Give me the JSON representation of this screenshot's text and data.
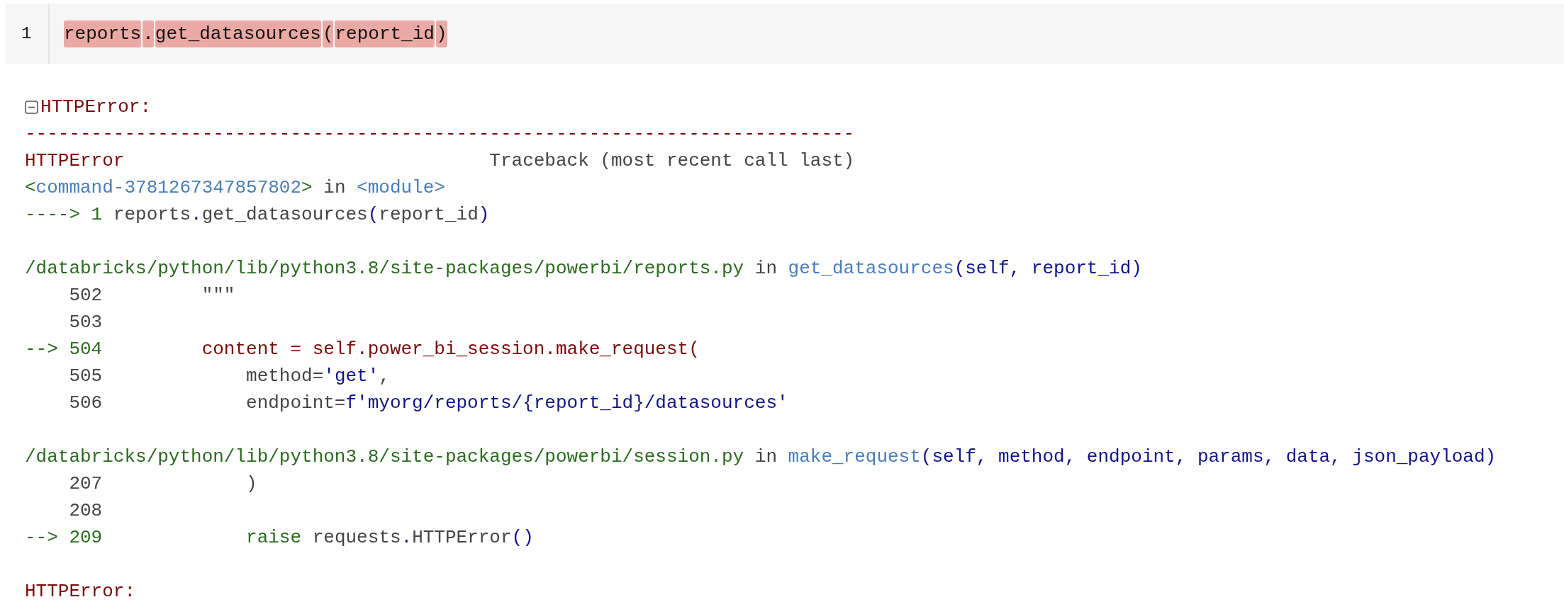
{
  "cell": {
    "line_number": "1",
    "tokens": [
      {
        "text": "reports",
        "error_highlight": true
      },
      {
        "text": ".",
        "error_highlight": true
      },
      {
        "text": "get_datasources",
        "error_highlight": true
      },
      {
        "text": "(",
        "error_highlight": true
      },
      {
        "text": "report_id",
        "error_highlight": true
      },
      {
        "text": ")",
        "error_highlight": true
      }
    ]
  },
  "output": {
    "expanded": true,
    "header": "HTTPError:",
    "blocks": [
      {
        "lines": [
          [
            {
              "text": "---------------------------------------------------------------------------",
              "kind": "error"
            }
          ],
          [
            {
              "text": "HTTPError",
              "kind": "error"
            },
            {
              "text": "                                 Traceback (most recent call last)",
              "kind": "plain"
            }
          ],
          [
            {
              "text": "<",
              "kind": "path"
            },
            {
              "text": "command-3781267347857802",
              "kind": "link"
            },
            {
              "text": ">",
              "kind": "path"
            },
            {
              "text": " in ",
              "kind": "plain"
            },
            {
              "text": "<module>",
              "kind": "link"
            }
          ],
          [
            {
              "text": "----> 1",
              "kind": "path"
            },
            {
              "text": " reports",
              "kind": "plain"
            },
            {
              "text": ".",
              "kind": "args"
            },
            {
              "text": "get_datasources",
              "kind": "plain"
            },
            {
              "text": "(",
              "kind": "args"
            },
            {
              "text": "report_id",
              "kind": "plain"
            },
            {
              "text": ")",
              "kind": "args"
            }
          ]
        ]
      },
      {
        "lines": [
          [
            {
              "text": "/databricks/python/lib/python3.8/site-packages/powerbi/reports.py",
              "kind": "path"
            },
            {
              "text": " in ",
              "kind": "plain"
            },
            {
              "text": "get_datasources",
              "kind": "link"
            },
            {
              "text": "(self, report_id)",
              "kind": "args"
            }
          ],
          [
            {
              "text": "    502         \"\"\"",
              "kind": "plain"
            }
          ],
          [
            {
              "text": "    503",
              "kind": "plain"
            }
          ],
          [
            {
              "text": "--> 504",
              "kind": "path"
            },
            {
              "text": "         content = self.power_bi_session.make_request(",
              "kind": "error"
            }
          ],
          [
            {
              "text": "    505             method=",
              "kind": "plain"
            },
            {
              "text": "'get'",
              "kind": "args"
            },
            {
              "text": ",",
              "kind": "plain"
            }
          ],
          [
            {
              "text": "    506             endpoint=",
              "kind": "plain"
            },
            {
              "text": "f'myorg/reports/{report_id}/datasources'",
              "kind": "args"
            }
          ]
        ]
      },
      {
        "lines": [
          [
            {
              "text": "/databricks/python/lib/python3.8/site-packages/powerbi/session.py",
              "kind": "path"
            },
            {
              "text": " in ",
              "kind": "plain"
            },
            {
              "text": "make_request",
              "kind": "link"
            },
            {
              "text": "(self, method, endpoint, params, data, json_payload)",
              "kind": "args"
            }
          ],
          [
            {
              "text": "    207             )",
              "kind": "plain"
            }
          ],
          [
            {
              "text": "    208",
              "kind": "plain"
            }
          ],
          [
            {
              "text": "--> 209             raise",
              "kind": "path"
            },
            {
              "text": " requests",
              "kind": "plain"
            },
            {
              "text": ".",
              "kind": "args"
            },
            {
              "text": "HTTPError",
              "kind": "plain"
            },
            {
              "text": "()",
              "kind": "args"
            }
          ]
        ]
      },
      {
        "lines": [
          [
            {
              "text": "HTTPError:",
              "kind": "error"
            }
          ]
        ]
      }
    ]
  }
}
